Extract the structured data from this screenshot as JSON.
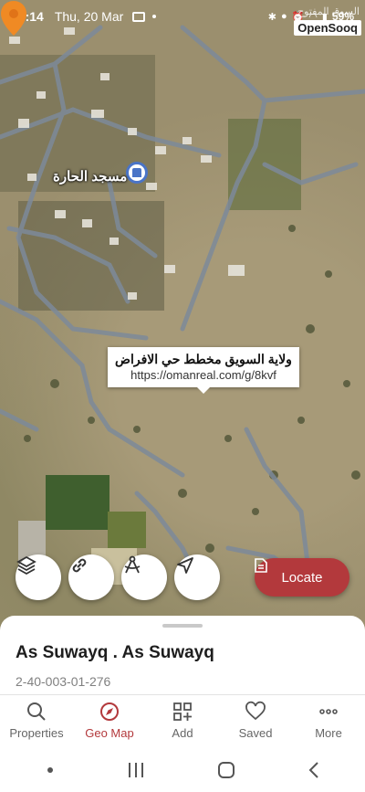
{
  "status_bar": {
    "time": "18:14",
    "date": "Thu, 20 Mar",
    "battery": "59%"
  },
  "watermark": {
    "brand": "OpenSooq",
    "arabic": "السوق المفتوح"
  },
  "map": {
    "poi_label": "مسجد الحارة",
    "callout_title": "ولاية السويق مخطط حي الافراض",
    "callout_url": "https://omanreal.com/g/8kvf"
  },
  "controls": {
    "layers_icon": "layers-icon",
    "link_icon": "link-icon",
    "measure_icon": "measure-icon",
    "navigate_icon": "navigate-icon",
    "locate_label": "Locate"
  },
  "place": {
    "title": "As Suwayq . As Suwayq",
    "id": "2-40-003-01-276"
  },
  "nav": {
    "items": [
      {
        "label": "Properties",
        "icon": "search-icon"
      },
      {
        "label": "Geo Map",
        "icon": "compass-icon"
      },
      {
        "label": "Add",
        "icon": "add-grid-icon"
      },
      {
        "label": "Saved",
        "icon": "heart-icon"
      },
      {
        "label": "More",
        "icon": "more-icon"
      }
    ],
    "active": "Geo Map"
  },
  "colors": {
    "accent": "#b3393c",
    "pin": "#f08a24"
  }
}
